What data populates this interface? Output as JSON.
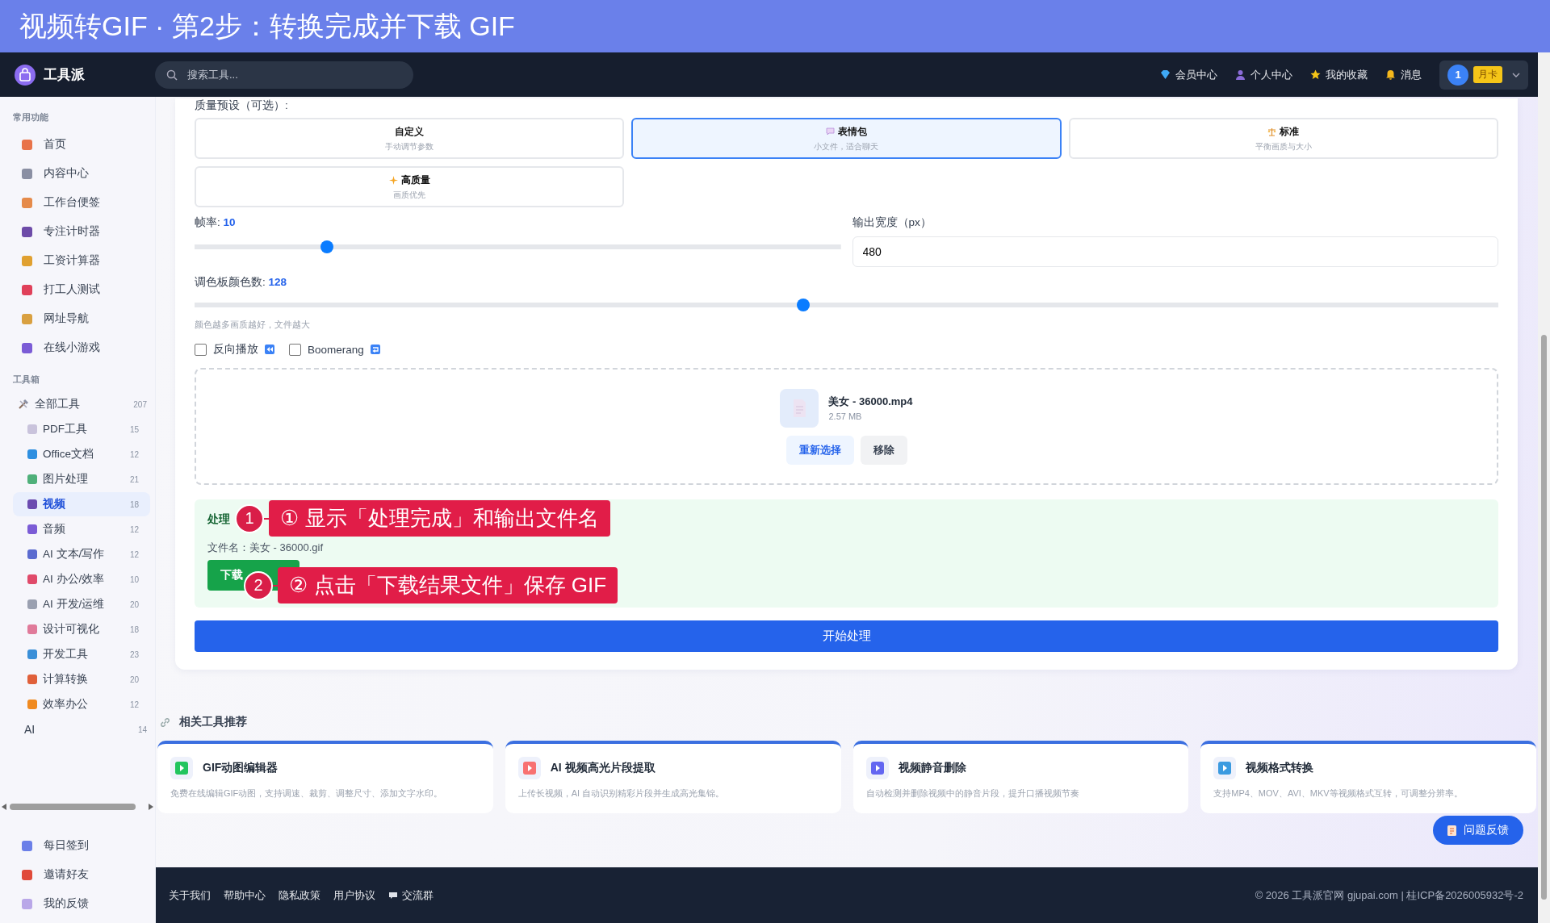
{
  "banner": {
    "title": "视频转GIF · 第2步：转换完成并下载 GIF"
  },
  "header": {
    "brand": "工具派",
    "search": {
      "placeholder": "搜索工具..."
    },
    "nav": [
      "会员中心",
      "个人中心",
      "我的收藏",
      "消息"
    ],
    "user": {
      "avatar": "1",
      "badge": "月卡"
    }
  },
  "sidebar": {
    "common": {
      "title": "常用功能",
      "items": [
        {
          "label": "首页"
        },
        {
          "label": "内容中心"
        },
        {
          "label": "工作台便签"
        },
        {
          "label": "专注计时器"
        },
        {
          "label": "工资计算器"
        },
        {
          "label": "打工人测试"
        },
        {
          "label": "网址导航"
        },
        {
          "label": "在线小游戏"
        }
      ]
    },
    "tools": {
      "title": "工具箱",
      "items": [
        {
          "label": "全部工具",
          "count": "207",
          "selected": false,
          "children": [
            {
              "label": "PDF工具",
              "count": "15",
              "selected": false
            },
            {
              "label": "Office文档",
              "count": "12",
              "selected": false
            },
            {
              "label": "图片处理",
              "count": "21",
              "selected": false
            },
            {
              "label": "视频",
              "count": "18",
              "selected": true
            },
            {
              "label": "音频",
              "count": "12",
              "selected": false
            },
            {
              "label": "AI 文本/写作",
              "count": "12",
              "selected": false
            },
            {
              "label": "AI 办公/效率",
              "count": "10",
              "selected": false
            },
            {
              "label": "AI 开发/运维",
              "count": "20",
              "selected": false
            },
            {
              "label": "设计可视化",
              "count": "18",
              "selected": false
            },
            {
              "label": "开发工具",
              "count": "23",
              "selected": false
            },
            {
              "label": "计算转换",
              "count": "20",
              "selected": false
            },
            {
              "label": "效率办公",
              "count": "12",
              "selected": false
            }
          ]
        },
        {
          "label": "AI",
          "count": "14",
          "selected": false
        }
      ]
    },
    "bottom": [
      {
        "label": "每日签到"
      },
      {
        "label": "邀请好友"
      },
      {
        "label": "我的反馈"
      }
    ]
  },
  "presets": {
    "label": "质量预设（可选）:",
    "options": [
      {
        "name": "自定义",
        "desc": "手动调节参数",
        "selected": false
      },
      {
        "name": "表情包",
        "desc": "小文件，适合聊天",
        "selected": true
      },
      {
        "name": "标准",
        "desc": "平衡画质与大小",
        "selected": false
      },
      {
        "name": "高质量",
        "desc": "画质优先",
        "selected": false
      }
    ]
  },
  "fps": {
    "label": "帧率:",
    "value": "10",
    "level": 0.205
  },
  "width": {
    "label": "输出宽度（px）",
    "value": "480"
  },
  "palette": {
    "label": "调色板颜色数:",
    "value": "128",
    "level": 0.467,
    "hint": "颜色越多画质越好，文件越大"
  },
  "options": [
    {
      "label": "反向播放",
      "checked": false
    },
    {
      "label": "Boomerang",
      "checked": false
    }
  ],
  "file": {
    "name": "美女 - 36000.mp4",
    "size": "2.57 MB",
    "buttons": [
      "重新选择",
      "移除"
    ]
  },
  "result": {
    "title": "处理",
    "filename": "文件名：美女 - 36000.gif",
    "button": "下载"
  },
  "callouts": [
    {
      "number": "1",
      "text": "① 显示「处理完成」和输出文件名"
    },
    {
      "number": "2",
      "text": "② 点击「下载结果文件」保存 GIF"
    }
  ],
  "start": "开始处理",
  "related": {
    "title": "相关工具推荐",
    "cards": [
      {
        "title": "GIF动图编辑器",
        "desc": "免费在线编辑GIF动图，支持调速、裁剪、调整尺寸、添加文字水印。"
      },
      {
        "title": "AI 视频高光片段提取",
        "desc": "上传长视频，AI 自动识别精彩片段并生成高光集锦。"
      },
      {
        "title": "视频静音删除",
        "desc": "自动检测并删除视频中的静音片段，提升口播视频节奏"
      },
      {
        "title": "视频格式转换",
        "desc": "支持MP4、MOV、AVI、MKV等视频格式互转，可调整分辨率。"
      }
    ]
  },
  "feedback": "问题反馈",
  "footer": {
    "links": [
      "关于我们",
      "帮助中心",
      "隐私政策",
      "用户协议"
    ],
    "chat": "交流群",
    "copyright": "© 2026 工具派官网 gjupai.com | 桂ICP备2026005932号-2"
  }
}
